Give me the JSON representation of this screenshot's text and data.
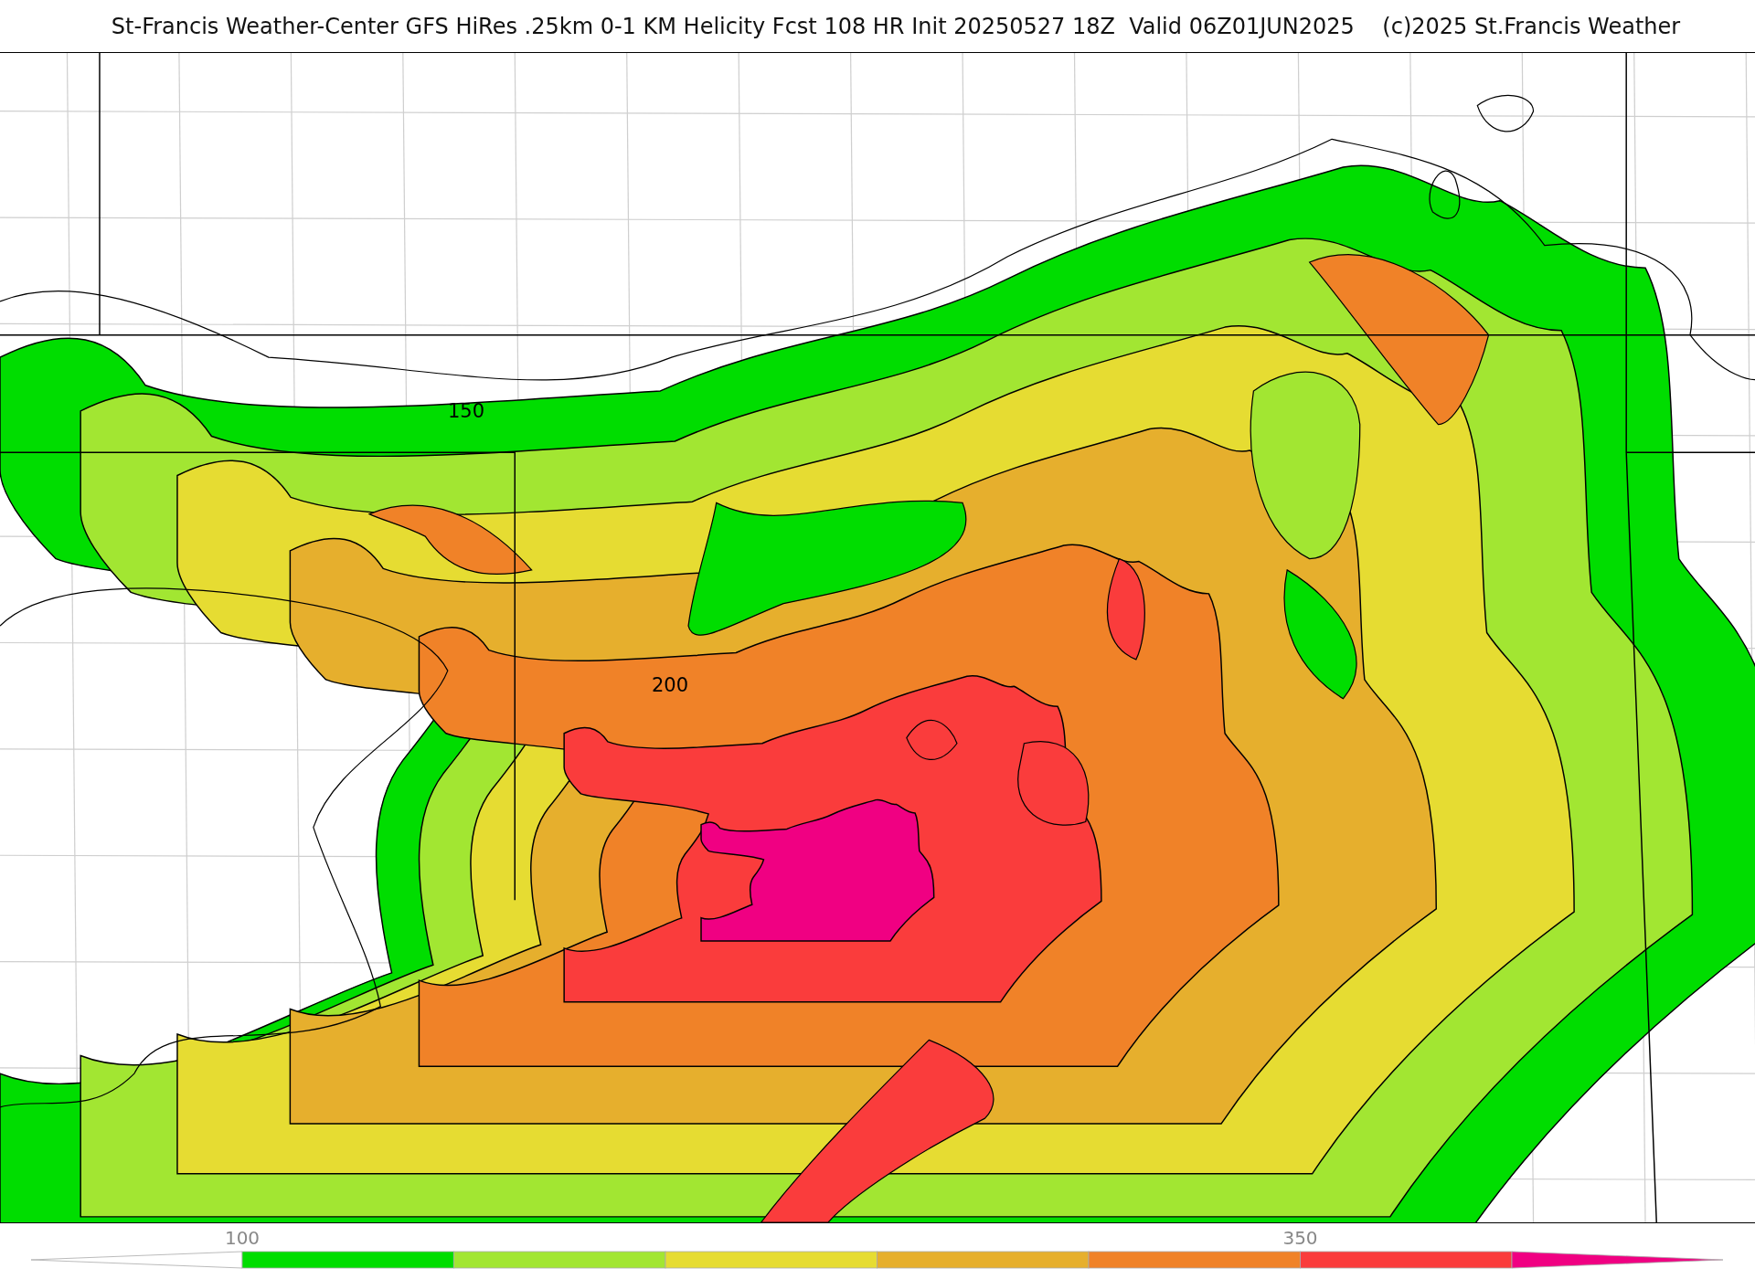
{
  "title": "St-Francis Weather-Center GFS HiRes .25km 0-1 KM Helicity Fcst 108 HR Init 20250527 18Z  Valid 06Z01JUN2025    (c)2025 St.Francis Weather",
  "map": {
    "contour_labels": [
      "150",
      "200"
    ]
  },
  "colorbar": {
    "bins": [
      {
        "kind": "arrow-left",
        "color": "#ffffff"
      },
      {
        "kind": "bar",
        "color": "#00dd00",
        "label": "100"
      },
      {
        "kind": "bar",
        "color": "#a2e632"
      },
      {
        "kind": "bar",
        "color": "#e6dc32"
      },
      {
        "kind": "bar",
        "color": "#e6af2d"
      },
      {
        "kind": "bar",
        "color": "#f08228"
      },
      {
        "kind": "bar",
        "color": "#fa3c3c",
        "label": "350"
      },
      {
        "kind": "arrow-right",
        "color": "#f00082"
      }
    ]
  }
}
